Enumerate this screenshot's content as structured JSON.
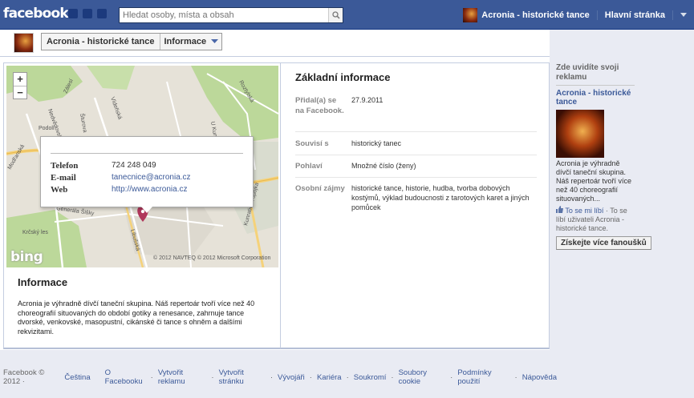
{
  "topbar": {
    "logo": "facebook",
    "search_placeholder": "Hledat osoby, místa a obsah",
    "user_name": "Acronia - historické tance",
    "home_label": "Hlavní stránka"
  },
  "subheader": {
    "page_name": "Acronia - historické tance",
    "section": "Informace"
  },
  "map": {
    "zoom_in": "+",
    "zoom_out": "−",
    "brand": "bing",
    "copyright": "© 2012 NAVTEQ © 2012 Microsoft Corporation",
    "street_labels": [
      "Zálesí",
      "Šturova",
      "Vídeňská",
      "Nedvědovská",
      "Podolí",
      "Generála Šišky",
      "Libušská",
      "Kunratická spojka",
      "U Kunratického lesa",
      "Roztylská",
      "Modřanská",
      "Krčský les"
    ],
    "contact": {
      "phone_label": "Telefon",
      "phone": "724 248 049",
      "email_label": "E-mail",
      "email": "tanecnice@acronia.cz",
      "web_label": "Web",
      "web": "http://www.acronia.cz"
    }
  },
  "about": {
    "heading": "Informace",
    "text": "Acronia je výhradně dívčí taneční skupina. Náš repertoár tvoří více než 40 choreografií situovaných do období gotiky a renesance, zahrnuje tance dvorské, venkovské, masopustní, cikánské či tance s ohněm a dalšími rekvizitami."
  },
  "basic_info": {
    "title": "Základní informace",
    "rows": [
      {
        "label": "Přidal(a) se na Facebook.",
        "value": "27.9.2011"
      },
      {
        "label": "Souvisí s",
        "value": "historický tanec"
      },
      {
        "label": "Pohlaví",
        "value": "Množné číslo (ženy)"
      },
      {
        "label": "Osobní zájmy",
        "value": "historické tance, historie, hudba, tvorba dobových kostýmů, výklad budoucnosti z tarotových karet a jiných pomůcek"
      }
    ]
  },
  "ads": {
    "heading": "Zde uvidíte svoji reklamu",
    "ad_title": "Acronia - historické tance",
    "ad_text": "Acronia je výhradně dívčí taneční skupina. Náš repertoár tvoří více než 40 choreografií situovaných...",
    "like_label": "To se mi líbí",
    "like_text": "· To se líbí uživateli Acronia - historické tance.",
    "cta": "Získejte více fanoušků"
  },
  "footer": {
    "copyright": "Facebook © 2012 ·",
    "language": "Čeština",
    "links": [
      "O Facebooku",
      "Vytvořit reklamu",
      "Vytvořit stránku",
      "Vývojáři",
      "Kariéra",
      "Soukromí",
      "Soubory cookie",
      "Podmínky použití",
      "Nápověda"
    ]
  },
  "colors": {
    "brand_blue": "#3b5998",
    "pin": "#b0375b"
  }
}
